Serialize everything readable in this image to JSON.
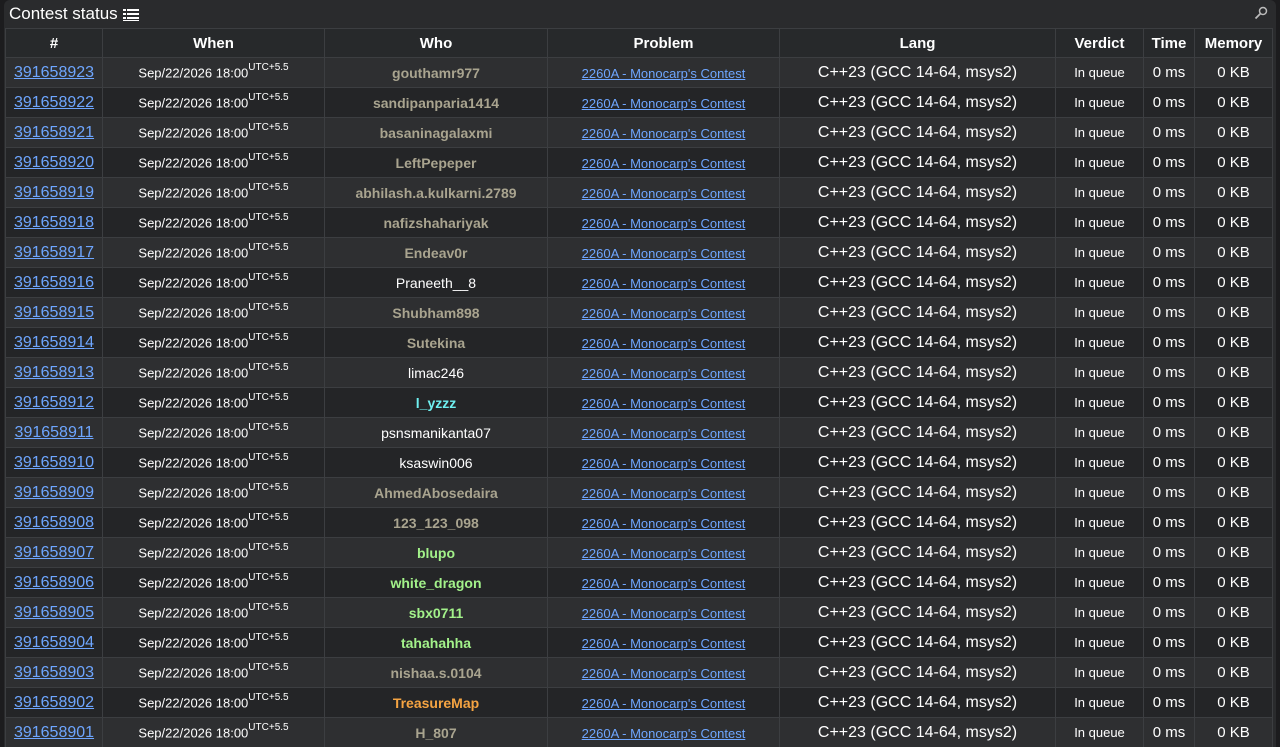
{
  "title": "Contest status",
  "columns": [
    "#",
    "When",
    "Who",
    "Problem",
    "Lang",
    "Verdict",
    "Time",
    "Memory"
  ],
  "common": {
    "when": "Sep/22/2026 18:00",
    "tz": "UTC+5.5",
    "problem": "2260A - Monocarp's Contest",
    "lang": "C++23 (GCC 14-64, msys2)",
    "verdict": "In queue",
    "time": "0 ms",
    "memory": "0 KB"
  },
  "colors": {
    "gray": "#a9a48f",
    "white": "#ffffff",
    "cyan": "#6ff0f0",
    "green": "#a3f28a",
    "orange": "#f5a442",
    "link": "#6ea6ff"
  },
  "rows": [
    {
      "id": "391658923",
      "who": "gouthamr977",
      "color": "gray",
      "bold": true
    },
    {
      "id": "391658922",
      "who": "sandipanparia1414",
      "color": "gray",
      "bold": true
    },
    {
      "id": "391658921",
      "who": "basaninagalaxmi",
      "color": "gray",
      "bold": true
    },
    {
      "id": "391658920",
      "who": "LeftPepeper",
      "color": "gray",
      "bold": true
    },
    {
      "id": "391658919",
      "who": "abhilash.a.kulkarni.2789",
      "color": "gray",
      "bold": true
    },
    {
      "id": "391658918",
      "who": "nafizshahariyak",
      "color": "gray",
      "bold": true
    },
    {
      "id": "391658917",
      "who": "Endeav0r",
      "color": "gray",
      "bold": true
    },
    {
      "id": "391658916",
      "who": "Praneeth__8",
      "color": "white",
      "bold": false
    },
    {
      "id": "391658915",
      "who": "Shubham898",
      "color": "gray",
      "bold": true
    },
    {
      "id": "391658914",
      "who": "Sutekina",
      "color": "gray",
      "bold": true
    },
    {
      "id": "391658913",
      "who": "limac246",
      "color": "white",
      "bold": false
    },
    {
      "id": "391658912",
      "who": "l_yzzz",
      "color": "cyan",
      "bold": true
    },
    {
      "id": "391658911",
      "who": "psnsmanikanta07",
      "color": "white",
      "bold": false
    },
    {
      "id": "391658910",
      "who": "ksaswin006",
      "color": "white",
      "bold": false
    },
    {
      "id": "391658909",
      "who": "AhmedAbosedaira",
      "color": "gray",
      "bold": true
    },
    {
      "id": "391658908",
      "who": "123_123_098",
      "color": "gray",
      "bold": true
    },
    {
      "id": "391658907",
      "who": "blupo",
      "color": "green",
      "bold": true
    },
    {
      "id": "391658906",
      "who": "white_dragon",
      "color": "green",
      "bold": true
    },
    {
      "id": "391658905",
      "who": "sbx0711",
      "color": "green",
      "bold": true
    },
    {
      "id": "391658904",
      "who": "tahahahha",
      "color": "green",
      "bold": true
    },
    {
      "id": "391658903",
      "who": "nishaa.s.0104",
      "color": "gray",
      "bold": true
    },
    {
      "id": "391658902",
      "who": "TreasureMap",
      "color": "orange",
      "bold": true
    },
    {
      "id": "391658901",
      "who": "H_807",
      "color": "gray",
      "bold": true
    }
  ]
}
